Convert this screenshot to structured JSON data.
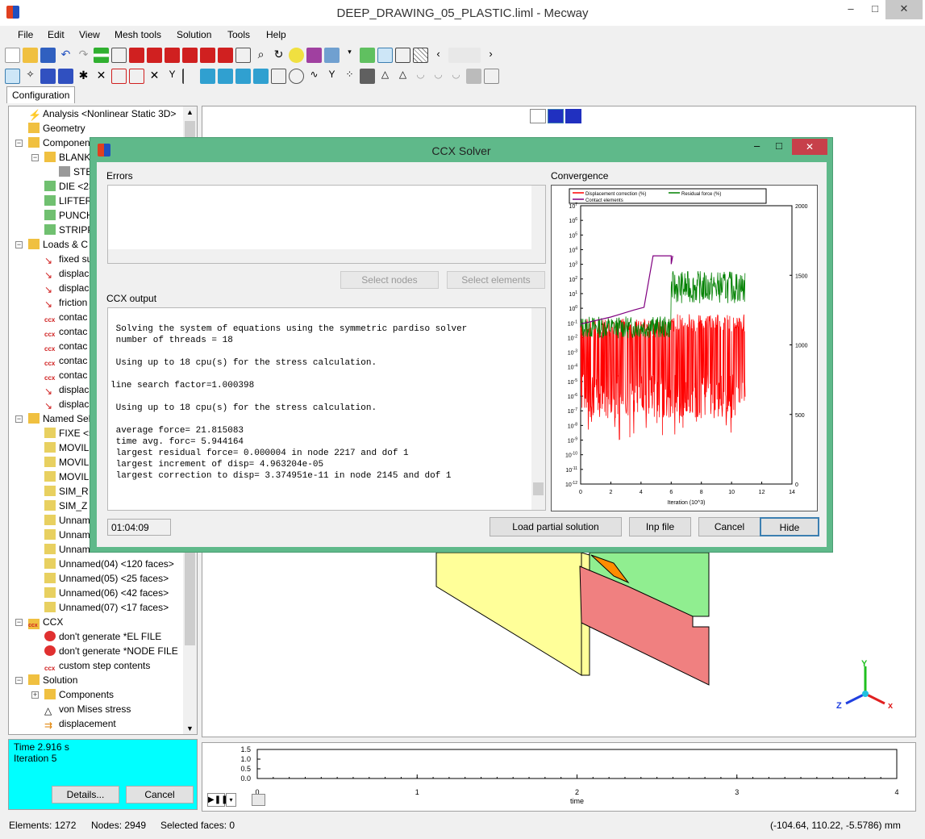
{
  "window": {
    "title": "DEEP_DRAWING_05_PLASTIC.liml - Mecway",
    "minimize": "–",
    "maximize": "□",
    "close": "✕"
  },
  "menu": [
    "File",
    "Edit",
    "View",
    "Mesh tools",
    "Solution",
    "Tools",
    "Help"
  ],
  "tabs": {
    "configuration": "Configuration"
  },
  "tree": {
    "analysis": "Analysis <Nonlinear Static 3D>",
    "geometry": "Geometry",
    "components": "Componen",
    "blank": "BLANK",
    "step": "STE",
    "die": "DIE <23",
    "lifter": "LIFTER",
    "punch": "PUNCH",
    "stripper": "STRIPP",
    "loads": "Loads & C",
    "load_items": [
      "fixed su",
      "displac",
      "displac",
      "friction",
      "contac",
      "contac",
      "contac",
      "contac",
      "contac",
      "displac",
      "displac"
    ],
    "named": "Named Sel",
    "named_items": [
      "FIXE <5",
      "MOVIL",
      "MOVIL",
      "MOVIL",
      "SIM_R",
      "SIM_Z",
      "Unnam",
      "Unnam",
      "Unnam",
      "Unnamed(04) <120 faces>",
      "Unnamed(05) <25 faces>",
      "Unnamed(06) <42 faces>",
      "Unnamed(07) <17 faces>"
    ],
    "ccx": "CCX",
    "ccx_items": [
      "don't generate *EL FILE",
      "don't generate *NODE FILE",
      "custom step contents"
    ],
    "solution": "Solution",
    "solution_items": [
      "Components",
      "von Mises stress",
      "displacement"
    ]
  },
  "status_panel": {
    "time": "Time 2.916 s",
    "iteration": "Iteration 5",
    "details_btn": "Details...",
    "cancel_btn": "Cancel"
  },
  "statusbar": {
    "elements": "Elements: 1272",
    "nodes": "Nodes: 2949",
    "selected": "Selected faces: 0",
    "coords": "(-104.64, 110.22, -5.5786) mm"
  },
  "timeline": {
    "y_ticks": [
      "1.5",
      "1.0",
      "0.5",
      "0.0"
    ],
    "x_ticks": [
      "0",
      "1",
      "2",
      "3",
      "4"
    ],
    "xlabel": "time"
  },
  "axis_triad": {
    "x": "x",
    "y": "Y",
    "z": "Z"
  },
  "dialog": {
    "title": "CCX Solver",
    "errors_label": "Errors",
    "convergence_label": "Convergence",
    "select_nodes": "Select nodes",
    "select_elements": "Select elements",
    "output_label": "CCX output",
    "output_lines": [
      "",
      " Solving the system of equations using the symmetric pardiso solver",
      " number of threads = 18",
      "",
      " Using up to 18 cpu(s) for the stress calculation.",
      "",
      "line search factor=1.000398",
      "",
      " Using up to 18 cpu(s) for the stress calculation.",
      "",
      " average force= 21.815083",
      " time avg. forc= 5.944164",
      " largest residual force= 0.000004 in node 2217 and dof 1",
      " largest increment of disp= 4.963204e-05",
      " largest correction to disp= 3.374951e-11 in node 2145 and dof 1"
    ],
    "elapsed": "01:04:09",
    "load_partial": "Load partial solution",
    "inp_file": "Inp file",
    "cancel": "Cancel",
    "hide": "Hide"
  },
  "chart_data": {
    "type": "line",
    "legend": [
      "Displacement correction (%)",
      "Residual force (%)",
      "Contact elements"
    ],
    "legend_position": "top",
    "xlabel": "Iteration (10^3)",
    "x_ticks": [
      "0",
      "2",
      "4",
      "6",
      "8",
      "10",
      "12",
      "14"
    ],
    "xlim": [
      0,
      14
    ],
    "y_left_log_ticks": [
      "10^7",
      "10^6",
      "10^5",
      "10^4",
      "10^3",
      "10^2",
      "10^1",
      "10^0",
      "10^-1",
      "10^-2",
      "10^-3",
      "10^-4",
      "10^-5",
      "10^-6",
      "10^-7",
      "10^-8",
      "10^-9",
      "10^-10",
      "10^-11",
      "10^-12"
    ],
    "y_right_ticks": [
      "2000",
      "1500",
      "1000",
      "500",
      "0"
    ],
    "y_right_lim": [
      0,
      2000
    ],
    "series": [
      {
        "name": "Displacement correction (%)",
        "color": "#ff0000"
      },
      {
        "name": "Residual force (%)",
        "color": "#008000"
      },
      {
        "name": "Contact elements",
        "color": "#800080"
      }
    ]
  },
  "colors": {
    "dialog_frame": "#5fb98a",
    "status_panel": "#00ffff",
    "blank_part": "#ffff99",
    "die_part": "#f08080",
    "punch_part": "#90ee90"
  }
}
